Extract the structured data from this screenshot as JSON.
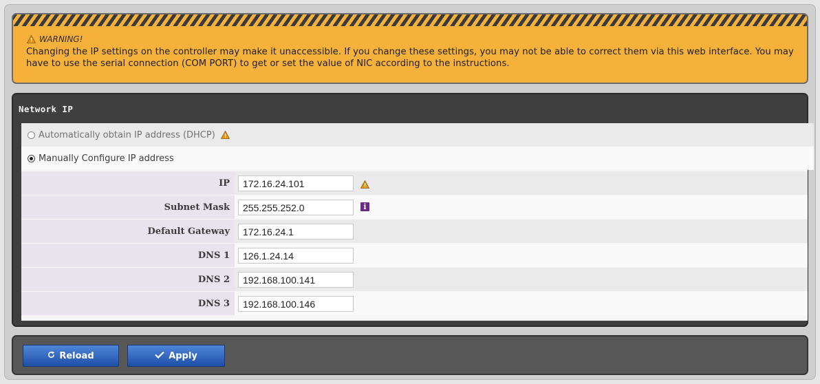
{
  "warning": {
    "title": "WARNING!",
    "message": "Changing the IP settings on the controller may make it unaccessible. If you change these settings, you may not be able to correct them via this web interface. You may have to use the serial connection (COM PORT) to get or set the value of NIC according to the instructions."
  },
  "network": {
    "title": "Network IP",
    "option_dhcp": "Automatically obtain IP address (DHCP)",
    "option_manual": "Manually Configure IP address",
    "selected": "manual",
    "fields": [
      {
        "label": "IP",
        "value": "172.16.24.101",
        "icon": "warning-icon"
      },
      {
        "label": "Subnet Mask",
        "value": "255.255.252.0",
        "icon": "info-icon"
      },
      {
        "label": "Default Gateway",
        "value": "172.16.24.1"
      },
      {
        "label": "DNS 1",
        "value": "126.1.24.14"
      },
      {
        "label": "DNS 2",
        "value": "192.168.100.141"
      },
      {
        "label": "DNS 3",
        "value": "192.168.100.146"
      }
    ]
  },
  "toolbar": {
    "reload_label": "Reload",
    "reload_icon": "refresh-icon",
    "apply_label": "Apply",
    "apply_icon": "checkmark-icon"
  },
  "colors": {
    "warning_bg": "#f6b13a",
    "button_blue": "#2a5cb8",
    "label_bg": "#e9e3ee"
  }
}
